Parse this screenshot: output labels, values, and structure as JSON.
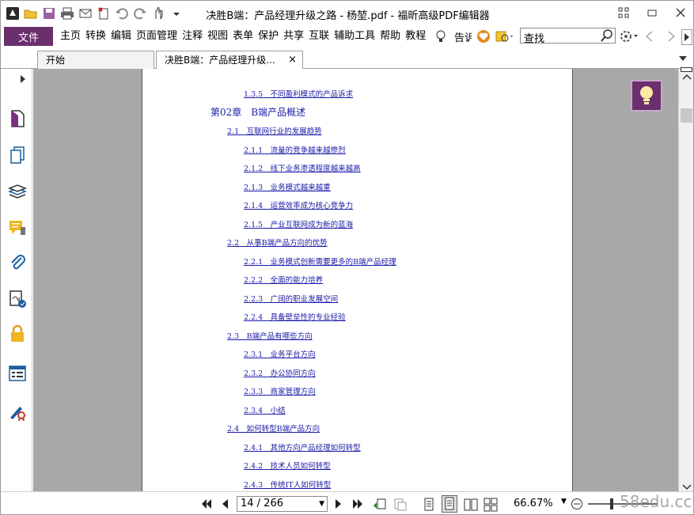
{
  "window": {
    "title": "决胜B端：产品经理升级之路 - 杨堃.pdf - 福昕高级PDF编辑器",
    "quick_access_icons": [
      "app-logo-icon",
      "open-folder-icon",
      "save-icon",
      "print-icon",
      "email-icon",
      "new-icon",
      "undo-icon",
      "redo-icon",
      "hand-tool-icon",
      "customize-icon"
    ],
    "controls": [
      "grid-icon",
      "minimize-icon",
      "close-icon"
    ]
  },
  "menubar": {
    "file_label": "文件",
    "items": [
      "主页",
      "转换",
      "编辑",
      "页面管理",
      "注释",
      "视图",
      "表单",
      "保护",
      "共享",
      "互联",
      "辅助工具",
      "帮助",
      "教程"
    ],
    "tell_me": "告诉",
    "search_label": "查找",
    "colors": {
      "accent": "#6b2f6e"
    }
  },
  "tabs": [
    {
      "label": "开始"
    },
    {
      "label": "决胜B端：产品经理升级...",
      "close": "×"
    }
  ],
  "sidebar": {
    "icons": [
      "page-thumbnail-icon",
      "pages-icon",
      "layers-icon",
      "comments-icon",
      "attachments-icon",
      "signature-icon",
      "security-icon",
      "form-fields-icon",
      "certify-icon"
    ]
  },
  "toc": [
    {
      "text": "1.3.5　不同盈利模式的产品诉求",
      "level": 3
    },
    {
      "text": "第02章　B端产品概述",
      "level": 1
    },
    {
      "text": "2.1　互联网行业的发展趋势",
      "level": 2
    },
    {
      "text": "2.1.1　流量的竞争越来越惨烈",
      "level": 3
    },
    {
      "text": "2.1.2　线下业务渗透程度越来越高",
      "level": 3
    },
    {
      "text": "2.1.3　业务模式越来越重",
      "level": 3
    },
    {
      "text": "2.1.4　运营效率成为核心竞争力",
      "level": 3
    },
    {
      "text": "2.1.5　产业互联网成为新的蓝海",
      "level": 3
    },
    {
      "text": "2.2　从事B端产品方向的优势",
      "level": 2
    },
    {
      "text": "2.2.1　业务模式创新需要更多的B端产品经理",
      "level": 3
    },
    {
      "text": "2.2.2　全面的能力培养",
      "level": 3
    },
    {
      "text": "2.2.3　广阔的职业发展空间",
      "level": 3
    },
    {
      "text": "2.2.4　具备壁垒性的专业经验",
      "level": 3
    },
    {
      "text": "2.3　B端产品有哪些方向",
      "level": 2
    },
    {
      "text": "2.3.1　业务平台方向",
      "level": 3
    },
    {
      "text": "2.3.2　办公协同方向",
      "level": 3
    },
    {
      "text": "2.3.3　商家管理方向",
      "level": 3
    },
    {
      "text": "2.3.4　小结",
      "level": 3
    },
    {
      "text": "2.4　如何转型B端产品方向",
      "level": 2
    },
    {
      "text": "2.4.1　其他方向产品经理如何转型",
      "level": 3
    },
    {
      "text": "2.4.2　技术人员如何转型",
      "level": 3
    },
    {
      "text": "2.4.3　传统IT人如何转型",
      "level": 3
    }
  ],
  "statusbar": {
    "page_value": "14 / 266",
    "zoom": "66.67%",
    "watermark": "58edu.cc"
  }
}
